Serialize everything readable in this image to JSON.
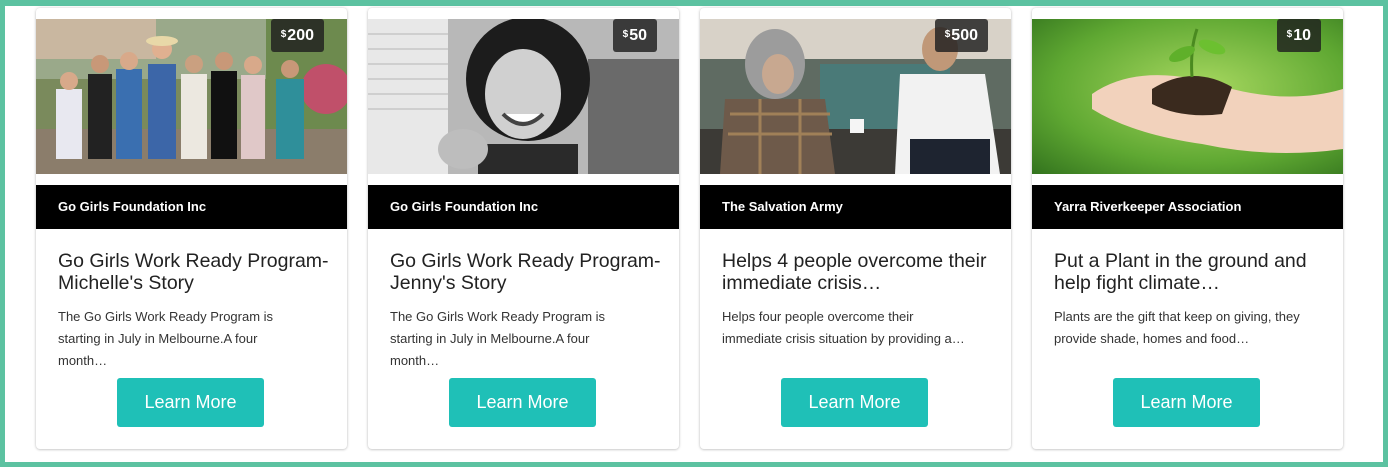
{
  "colors": {
    "frame": "#5cc2a1",
    "button": "#1fc0b7",
    "org_bar": "#000000",
    "price_badge": "#1e1e1e"
  },
  "cards": [
    {
      "price_symbol": "$",
      "price_amount": "200",
      "image_icon": "group-photo",
      "organization": "Go Girls Foundation Inc",
      "title": "Go Girls Work Ready Program- Michelle's Story",
      "description": "The Go Girls Work Ready Program is starting in July in Melbourne.A four month…",
      "button_label": "Learn More"
    },
    {
      "price_symbol": "$",
      "price_amount": "50",
      "image_icon": "portrait-photo",
      "organization": "Go Girls Foundation Inc",
      "title": "Go Girls Work Ready Program- Jenny's Story",
      "description": "The Go Girls Work Ready Program is starting in July in Melbourne.A four month…",
      "button_label": "Learn More"
    },
    {
      "price_symbol": "$",
      "price_amount": "500",
      "image_icon": "conversation-photo",
      "organization": "The Salvation Army",
      "title": "Helps 4 people overcome their immediate crisis…",
      "description": "Helps four people overcome their immediate crisis situation by providing a…",
      "button_label": "Learn More"
    },
    {
      "price_symbol": "$",
      "price_amount": "10",
      "image_icon": "seedling-photo",
      "organization": "Yarra Riverkeeper Association",
      "title": "Put a Plant in the ground and help fight climate…",
      "description": "Plants are the gift that keep on giving, they provide shade, homes and food…",
      "button_label": "Learn More"
    }
  ]
}
